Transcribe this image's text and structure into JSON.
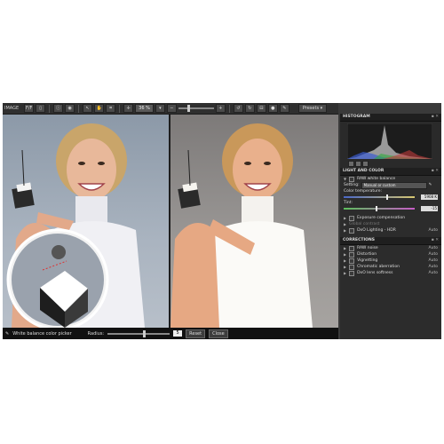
{
  "toolbar": {
    "title": "IMAGE",
    "zoom": "36 %",
    "presets_label": "Presets",
    "mode_label": "F/F"
  },
  "bottombar": {
    "tool_label": "White balance color picker",
    "radius_label": "Radius:",
    "radius_value": "5",
    "reset_label": "Reset",
    "close_label": "Close"
  },
  "panel": {
    "histogram_title": "HISTOGRAM",
    "light_title": "LIGHT AND COLOR",
    "raw_wb_label": "RAW white balance",
    "setting_label": "Setting:",
    "setting_value": "Manual or custom",
    "color_temp_label": "Color temperature:",
    "color_temp_value": "5908 K",
    "tint_label": "Tint:",
    "tint_value": "-15",
    "exposure_label": "Exposure compensation",
    "contrast_label": "Global contrast",
    "dxo_lighting_label": "DxO Lighting - HDR",
    "auto_label": "Auto",
    "corrections_title": "CORRECTIONS",
    "corrections": [
      {
        "label": "RAW noise",
        "auto": "Auto"
      },
      {
        "label": "Distortion",
        "auto": "Auto"
      },
      {
        "label": "Vignetting",
        "auto": "Auto"
      },
      {
        "label": "Chromatic aberration",
        "auto": "Auto"
      },
      {
        "label": "DxO lens softness",
        "auto": "Auto"
      }
    ]
  },
  "colors": {
    "app_bg": "#3a3a3a",
    "panel_bg": "#2c2c2c",
    "left_bg": "#aab4c0",
    "right_bg": "#9b9896"
  }
}
